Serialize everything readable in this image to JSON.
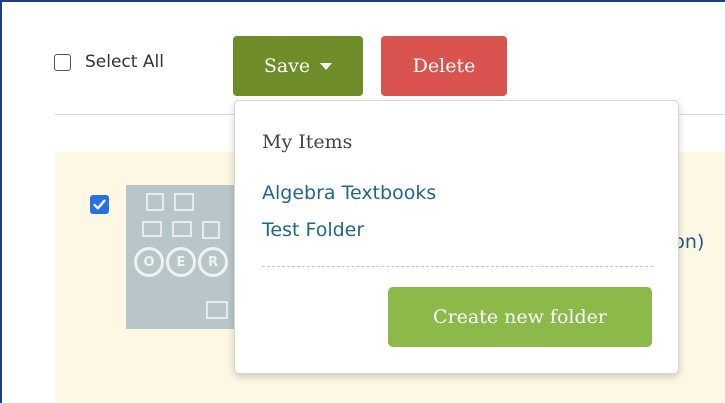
{
  "toolbar": {
    "select_all_label": "Select All",
    "save_label": "Save",
    "delete_label": "Delete"
  },
  "item": {
    "title_visible_tail": "ion)",
    "checked": true,
    "thumbnail_letters": [
      "O",
      "E",
      "R"
    ]
  },
  "dropdown": {
    "heading": "My Items",
    "folders": [
      "Algebra Textbooks",
      "Test Folder"
    ],
    "create_label": "Create new folder"
  },
  "colors": {
    "save": "#6e8c28",
    "delete": "#d9534f",
    "create": "#8db84a",
    "link": "#1f6690",
    "panel": "#fcf8e3",
    "frame": "#1d3f7a",
    "checkbox": "#2372e6"
  },
  "icons": {
    "save_caret": "caret-down-icon",
    "checked": "checkmark-icon"
  }
}
